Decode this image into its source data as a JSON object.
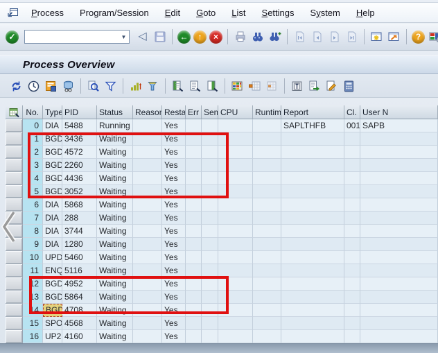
{
  "menubar": {
    "items": [
      {
        "label": "Process",
        "underline": 0
      },
      {
        "label": "Program/Session",
        "underline": 3
      },
      {
        "label": "Edit",
        "underline": 0
      },
      {
        "label": "Goto",
        "underline": 0
      },
      {
        "label": "List",
        "underline": 0
      },
      {
        "label": "Settings",
        "underline": 0
      },
      {
        "label": "System",
        "underline": 1
      },
      {
        "label": "Help",
        "underline": 0
      }
    ]
  },
  "toolbar": {
    "command_field": {
      "value": ""
    },
    "icons": [
      "enter",
      "command-field",
      "collapse",
      "save",
      "back",
      "exit",
      "cancel",
      "print",
      "find",
      "find-next",
      "first-page",
      "previous-page",
      "next-page",
      "last-page",
      "new-session",
      "create-shortcut",
      "help",
      "customize-layout"
    ]
  },
  "titlebar": {
    "title": "Process Overview"
  },
  "app_toolbar": {
    "icons": [
      "refresh",
      "cpu-time",
      "detail-info",
      "process-trace",
      "choose-detail",
      "filter",
      "sort-ascending",
      "sort-descending",
      "list-active",
      "list-all",
      "list-saved",
      "grid-view",
      "insert-column",
      "remove-column",
      "terminate-process",
      "export",
      "change",
      "calculator"
    ]
  },
  "table": {
    "columns": [
      "No.",
      "Type",
      "PID",
      "Status",
      "Reason",
      "Resta...",
      "Err",
      "Sem",
      "CPU",
      "Runtim...",
      "Report",
      "Cl.",
      "User N"
    ],
    "rows": [
      {
        "no": "0",
        "type": "DIA",
        "pid": "5488",
        "status": "Running",
        "reason": "",
        "restart": "Yes",
        "err": "",
        "sem": "",
        "cpu": "",
        "runtime": "",
        "report": "SAPLTHFB",
        "cl": "001",
        "user": "SAPB"
      },
      {
        "no": "1",
        "type": "BGD",
        "pid": "3436",
        "status": "Waiting",
        "reason": "",
        "restart": "Yes",
        "err": "",
        "sem": "",
        "cpu": "",
        "runtime": "",
        "report": "",
        "cl": "",
        "user": ""
      },
      {
        "no": "2",
        "type": "BGD",
        "pid": "4572",
        "status": "Waiting",
        "reason": "",
        "restart": "Yes",
        "err": "",
        "sem": "",
        "cpu": "",
        "runtime": "",
        "report": "",
        "cl": "",
        "user": ""
      },
      {
        "no": "3",
        "type": "BGD",
        "pid": "2260",
        "status": "Waiting",
        "reason": "",
        "restart": "Yes",
        "err": "",
        "sem": "",
        "cpu": "",
        "runtime": "",
        "report": "",
        "cl": "",
        "user": ""
      },
      {
        "no": "4",
        "type": "BGD",
        "pid": "4436",
        "status": "Waiting",
        "reason": "",
        "restart": "Yes",
        "err": "",
        "sem": "",
        "cpu": "",
        "runtime": "",
        "report": "",
        "cl": "",
        "user": ""
      },
      {
        "no": "5",
        "type": "BGD",
        "pid": "3052",
        "status": "Waiting",
        "reason": "",
        "restart": "Yes",
        "err": "",
        "sem": "",
        "cpu": "",
        "runtime": "",
        "report": "",
        "cl": "",
        "user": ""
      },
      {
        "no": "6",
        "type": "DIA",
        "pid": "5868",
        "status": "Waiting",
        "reason": "",
        "restart": "Yes",
        "err": "",
        "sem": "",
        "cpu": "",
        "runtime": "",
        "report": "",
        "cl": "",
        "user": ""
      },
      {
        "no": "7",
        "type": "DIA",
        "pid": "288",
        "status": "Waiting",
        "reason": "",
        "restart": "Yes",
        "err": "",
        "sem": "",
        "cpu": "",
        "runtime": "",
        "report": "",
        "cl": "",
        "user": ""
      },
      {
        "no": "8",
        "type": "DIA",
        "pid": "3744",
        "status": "Waiting",
        "reason": "",
        "restart": "Yes",
        "err": "",
        "sem": "",
        "cpu": "",
        "runtime": "",
        "report": "",
        "cl": "",
        "user": ""
      },
      {
        "no": "9",
        "type": "DIA",
        "pid": "1280",
        "status": "Waiting",
        "reason": "",
        "restart": "Yes",
        "err": "",
        "sem": "",
        "cpu": "",
        "runtime": "",
        "report": "",
        "cl": "",
        "user": ""
      },
      {
        "no": "10",
        "type": "UPD",
        "pid": "5460",
        "status": "Waiting",
        "reason": "",
        "restart": "Yes",
        "err": "",
        "sem": "",
        "cpu": "",
        "runtime": "",
        "report": "",
        "cl": "",
        "user": ""
      },
      {
        "no": "11",
        "type": "ENQ",
        "pid": "5116",
        "status": "Waiting",
        "reason": "",
        "restart": "Yes",
        "err": "",
        "sem": "",
        "cpu": "",
        "runtime": "",
        "report": "",
        "cl": "",
        "user": ""
      },
      {
        "no": "12",
        "type": "BGD",
        "pid": "4952",
        "status": "Waiting",
        "reason": "",
        "restart": "Yes",
        "err": "",
        "sem": "",
        "cpu": "",
        "runtime": "",
        "report": "",
        "cl": "",
        "user": ""
      },
      {
        "no": "13",
        "type": "BGD",
        "pid": "5864",
        "status": "Waiting",
        "reason": "",
        "restart": "Yes",
        "err": "",
        "sem": "",
        "cpu": "",
        "runtime": "",
        "report": "",
        "cl": "",
        "user": ""
      },
      {
        "no": "14",
        "type": "BGD",
        "pid": "4708",
        "status": "Waiting",
        "reason": "",
        "restart": "Yes",
        "err": "",
        "sem": "",
        "cpu": "",
        "runtime": "",
        "report": "",
        "cl": "",
        "user": ""
      },
      {
        "no": "15",
        "type": "SPO",
        "pid": "4568",
        "status": "Waiting",
        "reason": "",
        "restart": "Yes",
        "err": "",
        "sem": "",
        "cpu": "",
        "runtime": "",
        "report": "",
        "cl": "",
        "user": ""
      },
      {
        "no": "16",
        "type": "UP2",
        "pid": "4160",
        "status": "Waiting",
        "reason": "",
        "restart": "Yes",
        "err": "",
        "sem": "",
        "cpu": "",
        "runtime": "",
        "report": "",
        "cl": "",
        "user": ""
      }
    ],
    "selected_cell": {
      "row_no": "14",
      "field": "type",
      "highlight_color": "#e4d27d"
    }
  },
  "annotations": {
    "color": "#e01010",
    "boxes": [
      {
        "label": "highlight-rows-1-5",
        "rows": "1-5"
      },
      {
        "label": "highlight-rows-12-14",
        "rows": "12-14"
      }
    ]
  }
}
